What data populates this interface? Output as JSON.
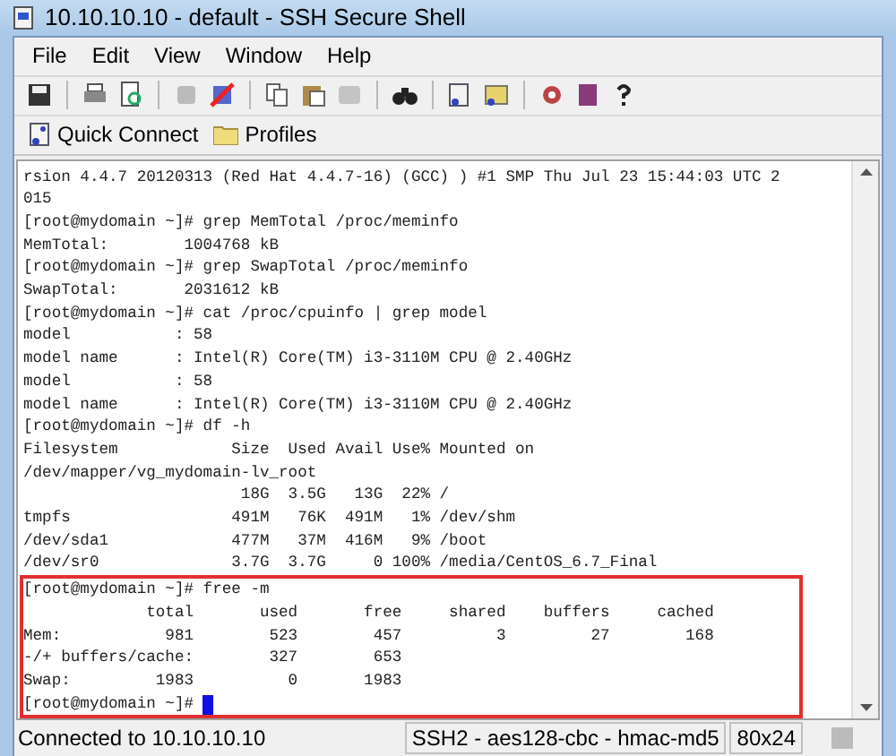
{
  "window": {
    "title": "10.10.10.10 - default - SSH Secure Shell"
  },
  "menu": [
    "File",
    "Edit",
    "View",
    "Window",
    "Help"
  ],
  "quick_bar": [
    {
      "kind": "connect",
      "label": "Quick Connect"
    },
    {
      "kind": "folder",
      "label": "Profiles"
    }
  ],
  "terminal": {
    "lines": [
      "rsion 4.4.7 20120313 (Red Hat 4.4.7-16) (GCC) ) #1 SMP Thu Jul 23 15:44:03 UTC 2",
      "015",
      "[root@mydomain ~]# grep MemTotal /proc/meminfo",
      "MemTotal:        1004768 kB",
      "[root@mydomain ~]# grep SwapTotal /proc/meminfo",
      "SwapTotal:       2031612 kB",
      "[root@mydomain ~]# cat /proc/cpuinfo | grep model",
      "model           : 58",
      "model name      : Intel(R) Core(TM) i3-3110M CPU @ 2.40GHz",
      "model           : 58",
      "model name      : Intel(R) Core(TM) i3-3110M CPU @ 2.40GHz",
      "[root@mydomain ~]# df -h",
      "Filesystem            Size  Used Avail Use% Mounted on",
      "/dev/mapper/vg_mydomain-lv_root",
      "                       18G  3.5G   13G  22% /",
      "tmpfs                 491M   76K  491M   1% /dev/shm",
      "/dev/sda1             477M   37M  416M   9% /boot",
      "/dev/sr0              3.7G  3.7G     0 100% /media/CentOS_6.7_Final"
    ],
    "highlighted_lines": [
      "[root@mydomain ~]# free -m",
      "             total       used       free     shared    buffers     cached",
      "Mem:           981        523        457          3         27        168",
      "-/+ buffers/cache:        327        653",
      "Swap:         1983          0       1983",
      "[root@mydomain ~]# "
    ],
    "cursor": true
  },
  "status_bar": [
    "Connected to 10.10.10.10",
    "SSH2 - aes128-cbc - hmac-md5",
    "80x24"
  ]
}
